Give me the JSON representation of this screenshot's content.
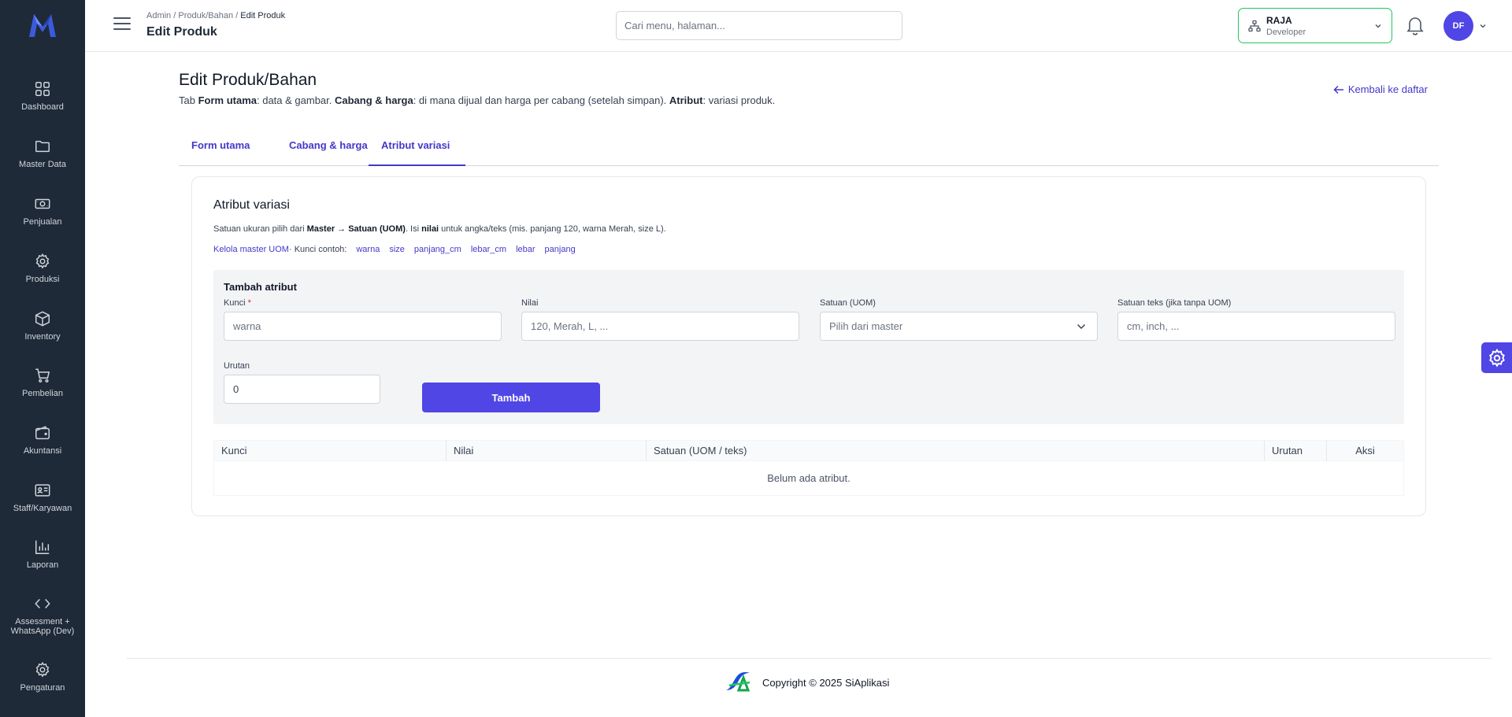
{
  "sidebar": {
    "items": [
      {
        "label": "Dashboard",
        "icon": "grid-icon"
      },
      {
        "label": "Master Data",
        "icon": "folder-icon"
      },
      {
        "label": "Penjualan",
        "icon": "cash-icon"
      },
      {
        "label": "Produksi",
        "icon": "gear-icon"
      },
      {
        "label": "Inventory",
        "icon": "box-icon"
      },
      {
        "label": "Pembelian",
        "icon": "cart-icon"
      },
      {
        "label": "Akuntansi",
        "icon": "wallet-icon"
      },
      {
        "label": "Staff/Karyawan",
        "icon": "id-card-icon"
      },
      {
        "label": "Laporan",
        "icon": "bar-chart-icon"
      },
      {
        "label": "Assessment + WhatsApp (Dev)",
        "icon": "code-icon"
      },
      {
        "label": "Pengaturan",
        "icon": "gear-icon"
      }
    ]
  },
  "header": {
    "breadcrumb": {
      "part1": "Admin",
      "part2": "Produk/Bahan",
      "current": "Edit Produk",
      "sep": " / "
    },
    "title": "Edit Produk",
    "search_placeholder": "Cari menu, halaman...",
    "branch": {
      "name": "RAJA",
      "role": "Developer"
    },
    "avatar_initials": "DF"
  },
  "page": {
    "title": "Edit Produk/Bahan",
    "subtitle": {
      "t1": "Tab ",
      "b1": "Form utama",
      "t2": ": data & gambar. ",
      "b2": "Cabang & harga",
      "t3": ": di mana dijual dan harga per cabang (setelah simpan). ",
      "b3": "Atribut",
      "t4": ": variasi produk."
    },
    "back_link": "Kembali ke daftar"
  },
  "tabs": [
    {
      "label": "Form utama",
      "active": false
    },
    {
      "label": "Cabang & harga",
      "active": false
    },
    {
      "label": "Atribut variasi",
      "active": true
    }
  ],
  "card": {
    "title": "Atribut variasi",
    "desc": {
      "t1": "Satuan ukuran pilih dari ",
      "b1": "Master → Satuan (UOM)",
      "t2": ". Isi ",
      "b2": "nilai",
      "t3": " untuk angka/teks (mis. panjang 120, warna Merah, size L)."
    },
    "uom_link": "Kelola master UOM",
    "keys_label": " · Kunci contoh:",
    "key_examples": [
      "warna",
      "size",
      "panjang_cm",
      "lebar_cm",
      "lebar",
      "panjang"
    ]
  },
  "add_form": {
    "title": "Tambah atribut",
    "key_label": "Kunci",
    "required_mark": "*",
    "key_placeholder": "warna",
    "value_label": "Nilai",
    "value_placeholder": "120, Merah, L, ...",
    "uom_label": "Satuan (UOM)",
    "uom_selected": "Pilih dari master",
    "unit_text_label": "Satuan teks (jika tanpa UOM)",
    "unit_text_placeholder": "cm, inch, ...",
    "order_label": "Urutan",
    "order_value": "0",
    "submit_label": "Tambah"
  },
  "table": {
    "columns": [
      "Kunci",
      "Nilai",
      "Satuan (UOM / teks)",
      "Urutan",
      "Aksi"
    ],
    "empty_text": "Belum ada atribut."
  },
  "footer": {
    "copyright": "Copyright © 2025 SiAplikasi"
  },
  "colors": {
    "sidebar_bg": "#1e2a38",
    "accent": "#4f46e5",
    "link": "#4338ca",
    "branch_border": "#22c55e"
  }
}
